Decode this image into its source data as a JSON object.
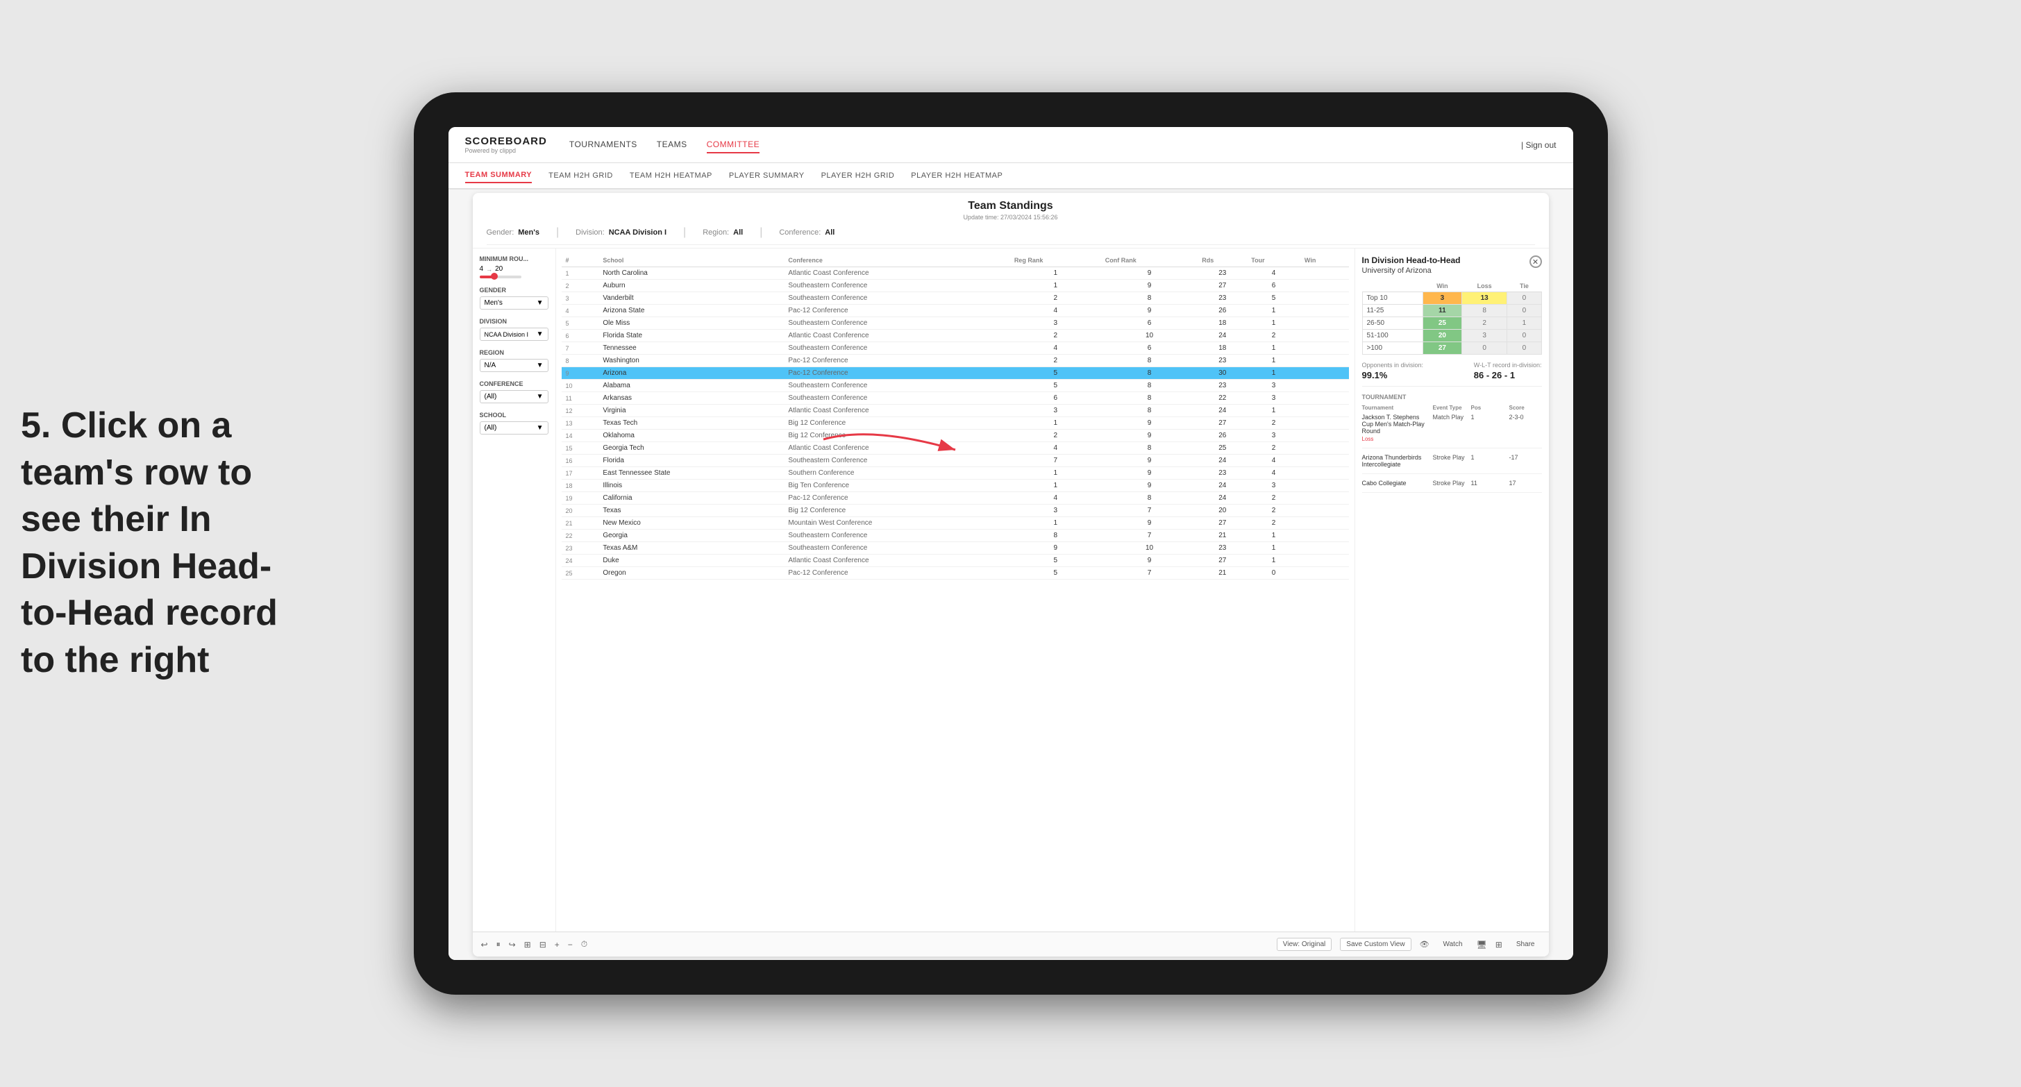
{
  "annotation": {
    "text": "5. Click on a team's row to see their In Division Head-to-Head record to the right"
  },
  "nav": {
    "logo": "SCOREBOARD",
    "logo_sub": "Powered by clippd",
    "links": [
      "TOURNAMENTS",
      "TEAMS",
      "COMMITTEE"
    ],
    "sign_out": "Sign out"
  },
  "sub_nav": {
    "links": [
      "TEAM SUMMARY",
      "TEAM H2H GRID",
      "TEAM H2H HEATMAP",
      "PLAYER SUMMARY",
      "PLAYER H2H GRID",
      "PLAYER H2H HEATMAP"
    ],
    "active": "TEAM SUMMARY"
  },
  "app": {
    "title": "Team Standings",
    "update_time": "Update time: 27/03/2024 15:56:26",
    "filters": {
      "gender_label": "Gender:",
      "gender_value": "Men's",
      "division_label": "Division:",
      "division_value": "NCAA Division I",
      "region_label": "Region:",
      "region_value": "All",
      "conference_label": "Conference:",
      "conference_value": "All"
    }
  },
  "sidebar": {
    "min_rounds_label": "Minimum Rou...",
    "min_rounds_value": "4",
    "min_rounds_max": "20",
    "gender_label": "Gender",
    "gender_value": "Men's",
    "division_label": "Division",
    "division_value": "NCAA Division I",
    "region_label": "Region",
    "region_value": "N/A",
    "conference_label": "Conference",
    "conference_value": "(All)",
    "school_label": "School",
    "school_value": "(All)"
  },
  "table": {
    "headers": [
      "#",
      "School",
      "Conference",
      "Reg Rank",
      "Conf Rank",
      "Rds",
      "Tour",
      "Win"
    ],
    "rows": [
      {
        "rank": 1,
        "school": "North Carolina",
        "conference": "Atlantic Coast Conference",
        "reg_rank": 1,
        "conf_rank": 9,
        "rds": 23,
        "tour": 4,
        "win": null
      },
      {
        "rank": 2,
        "school": "Auburn",
        "conference": "Southeastern Conference",
        "reg_rank": 1,
        "conf_rank": 9,
        "rds": 27,
        "tour": 6,
        "win": null
      },
      {
        "rank": 3,
        "school": "Vanderbilt",
        "conference": "Southeastern Conference",
        "reg_rank": 2,
        "conf_rank": 8,
        "rds": 23,
        "tour": 5,
        "win": null
      },
      {
        "rank": 4,
        "school": "Arizona State",
        "conference": "Pac-12 Conference",
        "reg_rank": 4,
        "conf_rank": 9,
        "rds": 26,
        "tour": 1,
        "win": null
      },
      {
        "rank": 5,
        "school": "Ole Miss",
        "conference": "Southeastern Conference",
        "reg_rank": 3,
        "conf_rank": 6,
        "rds": 18,
        "tour": 1,
        "win": null
      },
      {
        "rank": 6,
        "school": "Florida State",
        "conference": "Atlantic Coast Conference",
        "reg_rank": 2,
        "conf_rank": 10,
        "rds": 24,
        "tour": 2,
        "win": null
      },
      {
        "rank": 7,
        "school": "Tennessee",
        "conference": "Southeastern Conference",
        "reg_rank": 4,
        "conf_rank": 6,
        "rds": 18,
        "tour": 1,
        "win": null
      },
      {
        "rank": 8,
        "school": "Washington",
        "conference": "Pac-12 Conference",
        "reg_rank": 2,
        "conf_rank": 8,
        "rds": 23,
        "tour": 1,
        "win": null
      },
      {
        "rank": 9,
        "school": "Arizona",
        "conference": "Pac-12 Conference",
        "reg_rank": 5,
        "conf_rank": 8,
        "rds": 30,
        "tour": 1,
        "win": null,
        "highlighted": true
      },
      {
        "rank": 10,
        "school": "Alabama",
        "conference": "Southeastern Conference",
        "reg_rank": 5,
        "conf_rank": 8,
        "rds": 23,
        "tour": 3,
        "win": null
      },
      {
        "rank": 11,
        "school": "Arkansas",
        "conference": "Southeastern Conference",
        "reg_rank": 6,
        "conf_rank": 8,
        "rds": 22,
        "tour": 3,
        "win": null
      },
      {
        "rank": 12,
        "school": "Virginia",
        "conference": "Atlantic Coast Conference",
        "reg_rank": 3,
        "conf_rank": 8,
        "rds": 24,
        "tour": 1,
        "win": null
      },
      {
        "rank": 13,
        "school": "Texas Tech",
        "conference": "Big 12 Conference",
        "reg_rank": 1,
        "conf_rank": 9,
        "rds": 27,
        "tour": 2,
        "win": null
      },
      {
        "rank": 14,
        "school": "Oklahoma",
        "conference": "Big 12 Conference",
        "reg_rank": 2,
        "conf_rank": 9,
        "rds": 26,
        "tour": 3,
        "win": null
      },
      {
        "rank": 15,
        "school": "Georgia Tech",
        "conference": "Atlantic Coast Conference",
        "reg_rank": 4,
        "conf_rank": 8,
        "rds": 25,
        "tour": 2,
        "win": null
      },
      {
        "rank": 16,
        "school": "Florida",
        "conference": "Southeastern Conference",
        "reg_rank": 7,
        "conf_rank": 9,
        "rds": 24,
        "tour": 4,
        "win": null
      },
      {
        "rank": 17,
        "school": "East Tennessee State",
        "conference": "Southern Conference",
        "reg_rank": 1,
        "conf_rank": 9,
        "rds": 23,
        "tour": 4,
        "win": null
      },
      {
        "rank": 18,
        "school": "Illinois",
        "conference": "Big Ten Conference",
        "reg_rank": 1,
        "conf_rank": 9,
        "rds": 24,
        "tour": 3,
        "win": null
      },
      {
        "rank": 19,
        "school": "California",
        "conference": "Pac-12 Conference",
        "reg_rank": 4,
        "conf_rank": 8,
        "rds": 24,
        "tour": 2,
        "win": null
      },
      {
        "rank": 20,
        "school": "Texas",
        "conference": "Big 12 Conference",
        "reg_rank": 3,
        "conf_rank": 7,
        "rds": 20,
        "tour": 2,
        "win": null
      },
      {
        "rank": 21,
        "school": "New Mexico",
        "conference": "Mountain West Conference",
        "reg_rank": 1,
        "conf_rank": 9,
        "rds": 27,
        "tour": 2,
        "win": null
      },
      {
        "rank": 22,
        "school": "Georgia",
        "conference": "Southeastern Conference",
        "reg_rank": 8,
        "conf_rank": 7,
        "rds": 21,
        "tour": 1,
        "win": null
      },
      {
        "rank": 23,
        "school": "Texas A&M",
        "conference": "Southeastern Conference",
        "reg_rank": 9,
        "conf_rank": 10,
        "rds": 23,
        "tour": 1,
        "win": null
      },
      {
        "rank": 24,
        "school": "Duke",
        "conference": "Atlantic Coast Conference",
        "reg_rank": 5,
        "conf_rank": 9,
        "rds": 27,
        "tour": 1,
        "win": null
      },
      {
        "rank": 25,
        "school": "Oregon",
        "conference": "Pac-12 Conference",
        "reg_rank": 5,
        "conf_rank": 7,
        "rds": 21,
        "tour": 0,
        "win": null
      }
    ]
  },
  "h2h": {
    "title": "In Division Head-to-Head",
    "team": "University of Arizona",
    "categories": [
      "Win",
      "Loss",
      "Tie"
    ],
    "rows": [
      {
        "label": "Top 10",
        "win": 3,
        "loss": 13,
        "tie": 0,
        "win_color": "orange",
        "loss_color": "yellow"
      },
      {
        "label": "11-25",
        "win": 11,
        "loss": 8,
        "tie": 0,
        "win_color": "light-green",
        "loss_color": "zero"
      },
      {
        "label": "26-50",
        "win": 25,
        "loss": 2,
        "tie": 1,
        "win_color": "green",
        "loss_color": "zero"
      },
      {
        "label": "51-100",
        "win": 20,
        "loss": 3,
        "tie": 0,
        "win_color": "green",
        "loss_color": "zero"
      },
      {
        "label": ">100",
        "win": 27,
        "loss": 0,
        "tie": 0,
        "win_color": "green",
        "loss_color": "zero"
      }
    ],
    "opponents_pct_label": "Opponents in division:",
    "opponents_pct": "99.1%",
    "wlt_label": "W-L-T record in-division:",
    "wlt": "86 - 26 - 1",
    "tournaments": [
      {
        "name": "Jackson T. Stephens Cup Men's Match-Play Round",
        "event_type": "Match Play",
        "result": "Loss",
        "score": "2-3-0",
        "pos": 1
      },
      {
        "name": "Arizona Thunderbirds Intercollegiate",
        "event_type": "Stroke Play",
        "result": "",
        "score": "-17",
        "pos": 1
      },
      {
        "name": "Cabo Collegiate",
        "event_type": "Stroke Play",
        "result": "",
        "score": "17",
        "pos": 11
      }
    ]
  },
  "toolbar": {
    "view_original": "View: Original",
    "save_custom": "Save Custom View",
    "watch": "Watch",
    "share": "Share"
  }
}
